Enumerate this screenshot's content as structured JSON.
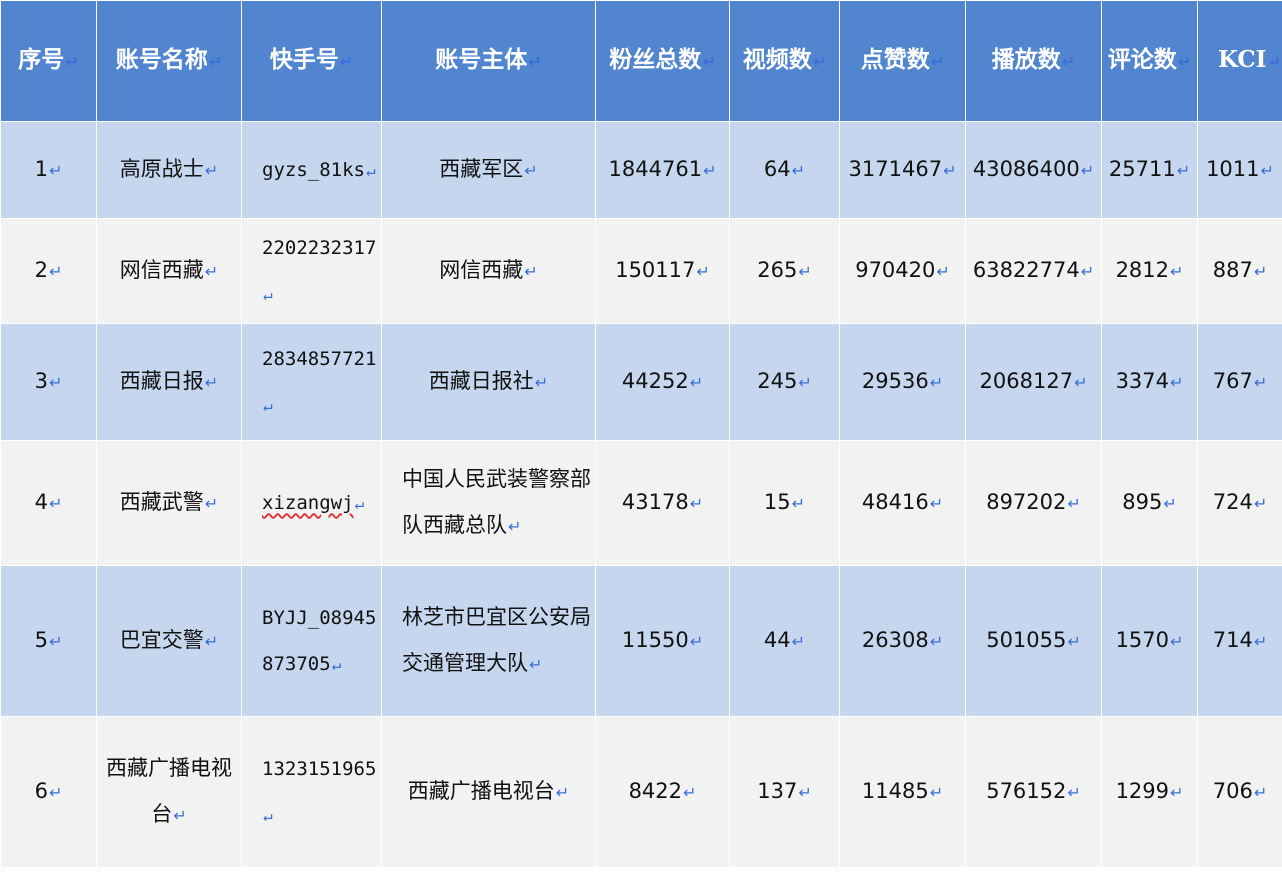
{
  "mark": "↵",
  "headers": [
    {
      "name": "index",
      "label": "序号"
    },
    {
      "name": "account-name",
      "label": "账号名称"
    },
    {
      "name": "kuaishou-id",
      "label": "快手号"
    },
    {
      "name": "account-entity",
      "label": "账号主体"
    },
    {
      "name": "followers",
      "label": "粉丝总数"
    },
    {
      "name": "videos",
      "label": "视频数"
    },
    {
      "name": "likes",
      "label": "点赞数"
    },
    {
      "name": "plays",
      "label": "播放数"
    },
    {
      "name": "comments",
      "label": "评论数"
    },
    {
      "name": "kci",
      "label": "KCI"
    }
  ],
  "rows": [
    {
      "index": "1",
      "name": "高原战士",
      "kuaishou_id": "gyzs_81ks",
      "entity": "西藏军区",
      "followers": "1844761",
      "videos": "64",
      "likes": "3171467",
      "plays": "43086400",
      "comments": "25711",
      "kci": "1011"
    },
    {
      "index": "2",
      "name": "网信西藏",
      "kuaishou_id": "2202232317",
      "entity": "网信西藏",
      "followers": "150117",
      "videos": "265",
      "likes": "970420",
      "plays": "63822774",
      "comments": "2812",
      "kci": "887"
    },
    {
      "index": "3",
      "name": "西藏日报",
      "kuaishou_id": "2834857721",
      "entity": "西藏日报社",
      "followers": "44252",
      "videos": "245",
      "likes": "29536",
      "plays": "2068127",
      "comments": "3374",
      "kci": "767"
    },
    {
      "index": "4",
      "name": "西藏武警",
      "kuaishou_id": "xizangwj",
      "entity": "中国人民武装警察部队西藏总队",
      "followers": "43178",
      "videos": "15",
      "likes": "48416",
      "plays": "897202",
      "comments": "895",
      "kci": "724"
    },
    {
      "index": "5",
      "name": "巴宜交警",
      "kuaishou_id": "BYJJ_08945873705",
      "entity": "林芝市巴宜区公安局交通管理大队",
      "followers": "11550",
      "videos": "44",
      "likes": "26308",
      "plays": "501055",
      "comments": "1570",
      "kci": "714"
    },
    {
      "index": "6",
      "name": "西藏广播电视台",
      "kuaishou_id": "1323151965",
      "entity": "西藏广播电视台",
      "followers": "8422",
      "videos": "137",
      "likes": "11485",
      "plays": "576152",
      "comments": "1299",
      "kci": "706"
    }
  ]
}
